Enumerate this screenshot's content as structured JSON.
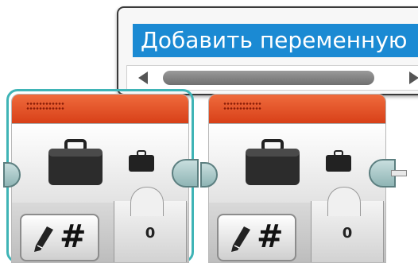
{
  "dropdown": {
    "selected_item_label": "Добавить переменную"
  },
  "blocks": [
    {
      "value": "0"
    },
    {
      "value": "0"
    }
  ],
  "colors": {
    "header_orange": "#e45526",
    "selection_teal": "#3fb4b6",
    "highlight_blue": "#1b8ad3"
  }
}
